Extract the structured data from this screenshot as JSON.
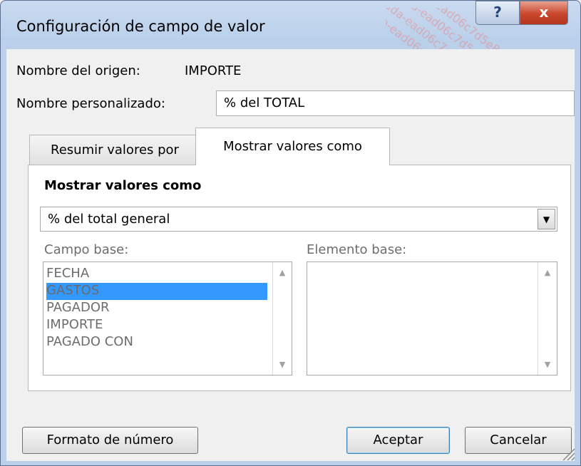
{
  "window": {
    "title": "Configuración de campo de valor",
    "help_label": "?",
    "close_label": "x"
  },
  "source": {
    "label": "Nombre del origen:",
    "value": "IMPORTE"
  },
  "custom_name": {
    "label": "Nombre personalizado:",
    "value": "% del TOTAL"
  },
  "tabs": [
    {
      "label": "Resumir valores por",
      "selected": false
    },
    {
      "label": "Mostrar valores como",
      "selected": true
    }
  ],
  "panel": {
    "heading": "Mostrar valores como",
    "show_as_selected": "% del total general",
    "base_field_label": "Campo base:",
    "base_item_label": "Elemento base:",
    "base_fields": [
      {
        "label": "FECHA",
        "selected": false
      },
      {
        "label": "GASTOS",
        "selected": true
      },
      {
        "label": "PAGADOR",
        "selected": false
      },
      {
        "label": "IMPORTE",
        "selected": false
      },
      {
        "label": "PAGADO CON",
        "selected": false
      }
    ]
  },
  "buttons": {
    "number_format": "Formato de número",
    "ok": "Aceptar",
    "cancel": "Cancelar"
  },
  "watermark": "3-aada-ead06c7d5e84 Lligoña",
  "colors": {
    "selection": "#3399ff",
    "titlebar": "#b9cfea",
    "close": "#c9462c"
  }
}
